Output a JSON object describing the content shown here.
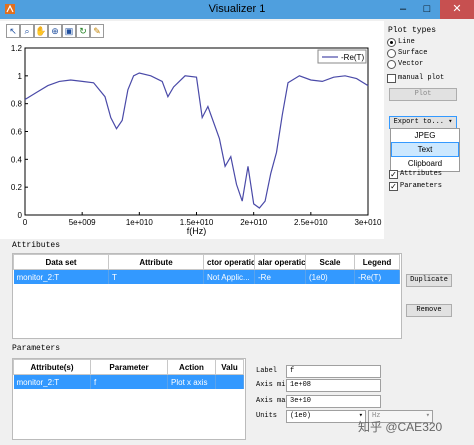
{
  "window": {
    "title": "Visualizer 1",
    "minimize": "–",
    "maximize": "□",
    "close": "✕"
  },
  "toolbar": {
    "icons": [
      "pointer-icon",
      "zoom-icon",
      "pan-icon",
      "zoom-in-icon",
      "camera-icon",
      "reset-icon",
      "pen-icon"
    ]
  },
  "chart_data": {
    "type": "line",
    "xlabel": "f(Hz)",
    "ylabel": "",
    "xlim": [
      0,
      30000000000
    ],
    "ylim": [
      0,
      1.2
    ],
    "x_ticks": [
      "0",
      "5e+009",
      "1e+010",
      "1.5e+010",
      "2e+010",
      "2.5e+010",
      "3e+010"
    ],
    "y_ticks": [
      "0",
      "0.2",
      "0.4",
      "0.6",
      "0.8",
      "1",
      "1.2"
    ],
    "legend_position": "top-right",
    "series": [
      {
        "name": "-Re(T)",
        "x": [
          0,
          1000000000.0,
          2000000000.0,
          3000000000.0,
          4000000000.0,
          5000000000.0,
          6000000000.0,
          7000000000.0,
          7500000000.0,
          8000000000.0,
          8500000000.0,
          9000000000.0,
          9500000000.0,
          10000000000.0,
          11000000000.0,
          12000000000.0,
          12500000000.0,
          13000000000.0,
          14000000000.0,
          15000000000.0,
          15500000000.0,
          16000000000.0,
          17000000000.0,
          17500000000.0,
          18000000000.0,
          18500000000.0,
          19000000000.0,
          19500000000.0,
          20000000000.0,
          20500000000.0,
          21000000000.0,
          21500000000.0,
          22000000000.0,
          22500000000.0,
          23000000000.0,
          24000000000.0,
          25000000000.0,
          26000000000.0,
          27000000000.0,
          28000000000.0,
          29000000000.0,
          30000000000.0
        ],
        "values": [
          0.83,
          0.88,
          0.93,
          0.96,
          0.97,
          0.96,
          0.95,
          0.85,
          0.7,
          0.62,
          0.68,
          0.9,
          1.0,
          1.02,
          1.0,
          0.96,
          0.85,
          0.92,
          1.0,
          0.99,
          0.7,
          0.78,
          0.55,
          0.35,
          0.42,
          0.22,
          0.1,
          0.35,
          0.08,
          0.05,
          0.1,
          0.3,
          0.45,
          0.72,
          0.95,
          1.0,
          0.97,
          0.96,
          0.99,
          1.0,
          0.98,
          0.93
        ]
      }
    ]
  },
  "plot_types": {
    "title": "Plot types",
    "options": [
      "Line",
      "Surface",
      "Vector"
    ],
    "selected": "Line",
    "manual_plot_label": "manual plot",
    "plot_button": "Plot",
    "export_button": "Export to...",
    "export_menu": [
      "JPEG",
      "Text",
      "Clipboard"
    ],
    "export_highlighted": "Text",
    "attributes_check": "Attributes",
    "parameters_check": "Parameters"
  },
  "attributes": {
    "title": "Attributes",
    "columns": [
      "Data set",
      "Attribute",
      "ctor operatic",
      "alar operatic",
      "Scale",
      "Legend"
    ],
    "rows": [
      [
        "monitor_2:T",
        "T",
        "Not Applic...",
        "-Re",
        "(1e0)",
        "-Re(T)"
      ]
    ],
    "duplicate_button": "Duplicate",
    "remove_button": "Remove"
  },
  "parameters": {
    "title": "Parameters",
    "columns": [
      "Attribute(s)",
      "Parameter",
      "Action",
      "Valu"
    ],
    "rows": [
      [
        "monitor_2:T",
        "f",
        "Plot x axis",
        ""
      ]
    ],
    "label_label": "Label",
    "label_value": "f",
    "axis_min_label": "Axis min",
    "axis_min_value": "1e+08",
    "axis_max_label": "Axis max",
    "axis_max_value": "3e+10",
    "units_label": "Units",
    "units_value": "(1e0)",
    "units2_value": "Hz"
  },
  "watermark": "知乎 @CAE320"
}
